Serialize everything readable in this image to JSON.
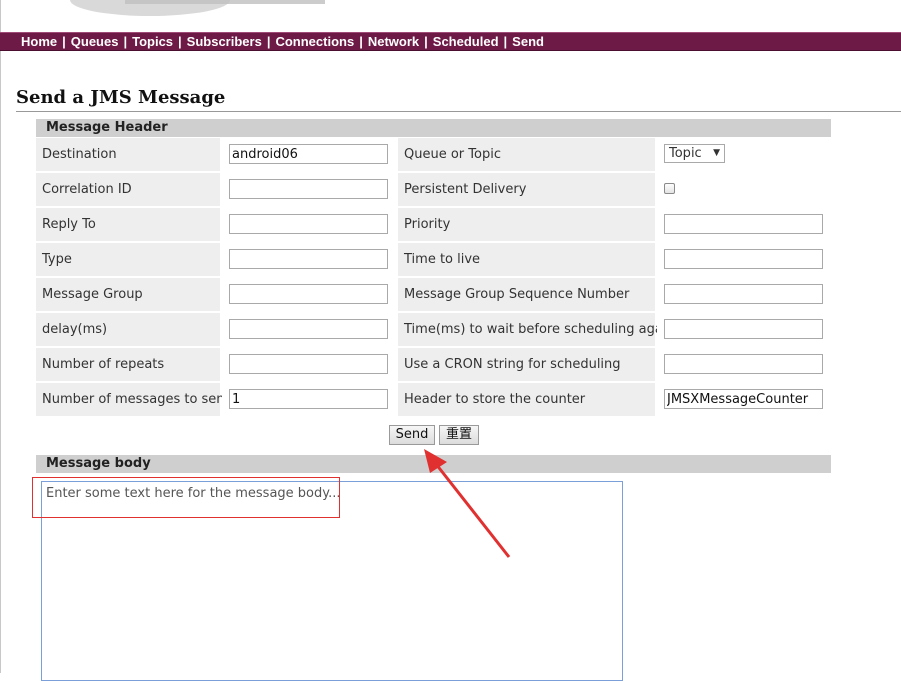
{
  "nav": {
    "items": [
      "Home",
      "Queues",
      "Topics",
      "Subscribers",
      "Connections",
      "Network",
      "Scheduled",
      "Send"
    ],
    "separator": "|"
  },
  "page": {
    "title": "Send a JMS Message"
  },
  "header_section": {
    "title": "Message Header",
    "rows": [
      {
        "label_left": "Destination",
        "value_left": "android06",
        "label_right": "Queue or Topic",
        "right_type": "select",
        "right_value": "Topic"
      },
      {
        "label_left": "Correlation ID",
        "value_left": "",
        "label_right": "Persistent Delivery",
        "right_type": "checkbox",
        "right_value": ""
      },
      {
        "label_left": "Reply To",
        "value_left": "",
        "label_right": "Priority",
        "right_type": "text",
        "right_value": ""
      },
      {
        "label_left": "Type",
        "value_left": "",
        "label_right": "Time to live",
        "right_type": "text",
        "right_value": ""
      },
      {
        "label_left": "Message Group",
        "value_left": "",
        "label_right": "Message Group Sequence Number",
        "right_type": "text",
        "right_value": ""
      },
      {
        "label_left": "delay(ms)",
        "value_left": "",
        "label_right": "Time(ms) to wait before scheduling again",
        "right_type": "text",
        "right_value": ""
      },
      {
        "label_left": "Number of repeats",
        "value_left": "",
        "label_right": "Use a CRON string for scheduling",
        "right_type": "text",
        "right_value": ""
      },
      {
        "label_left": "Number of messages to send",
        "value_left": "1",
        "label_right": "Header to store the counter",
        "right_type": "text",
        "right_value": "JMSXMessageCounter"
      }
    ]
  },
  "buttons": {
    "send": "Send",
    "reset": "重置"
  },
  "body_section": {
    "title": "Message body",
    "text": "Enter some text here for the message body..."
  },
  "colors": {
    "nav_bg": "#6e1a46",
    "section_bg": "#cfcfcf",
    "annotation": "#e03030"
  }
}
